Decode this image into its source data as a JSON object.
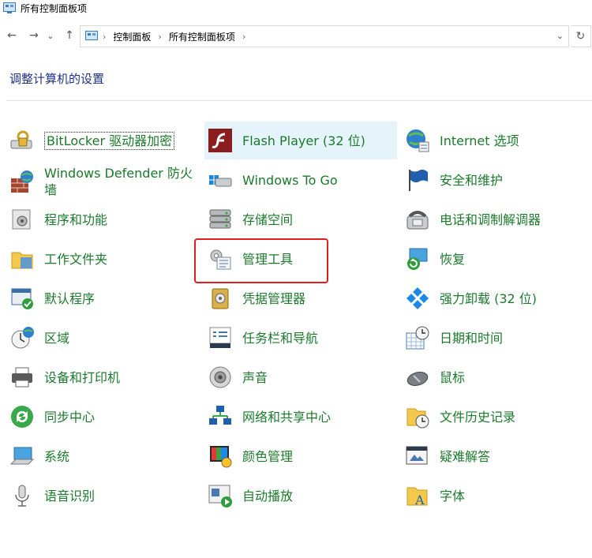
{
  "window": {
    "title": "所有控制面板项"
  },
  "nav": {
    "back": "←",
    "forward": "→",
    "recent": "⌄",
    "up": "↑",
    "refresh": "↻",
    "dropdown": "⌄",
    "separator": "›",
    "breadcrumb": [
      "控制面板",
      "所有控制面板项"
    ]
  },
  "page": {
    "heading": "调整计算机的设置"
  },
  "columns": [
    [
      {
        "label": "BitLocker 驱动器加密",
        "icon": "bitlocker-icon"
      },
      {
        "label": "Windows Defender 防火墙",
        "icon": "firewall-icon"
      },
      {
        "label": "程序和功能",
        "icon": "programs-icon"
      },
      {
        "label": "工作文件夹",
        "icon": "work-folders-icon"
      },
      {
        "label": "默认程序",
        "icon": "default-programs-icon"
      },
      {
        "label": "区域",
        "icon": "region-icon"
      },
      {
        "label": "设备和打印机",
        "icon": "printer-icon"
      },
      {
        "label": "同步中心",
        "icon": "sync-icon"
      },
      {
        "label": "系统",
        "icon": "system-icon"
      },
      {
        "label": "语音识别",
        "icon": "microphone-icon"
      }
    ],
    [
      {
        "label": "Flash Player (32 位)",
        "icon": "flash-icon"
      },
      {
        "label": "Windows To Go",
        "icon": "usb-drive-icon"
      },
      {
        "label": "存储空间",
        "icon": "storage-icon"
      },
      {
        "label": "管理工具",
        "icon": "admin-tools-icon"
      },
      {
        "label": "凭据管理器",
        "icon": "credential-icon"
      },
      {
        "label": "任务栏和导航",
        "icon": "taskbar-icon"
      },
      {
        "label": "声音",
        "icon": "speaker-icon"
      },
      {
        "label": "网络和共享中心",
        "icon": "network-icon"
      },
      {
        "label": "颜色管理",
        "icon": "color-icon"
      },
      {
        "label": "自动播放",
        "icon": "autoplay-icon"
      }
    ],
    [
      {
        "label": "Internet 选项",
        "icon": "internet-icon"
      },
      {
        "label": "安全和维护",
        "icon": "flag-icon"
      },
      {
        "label": "电话和调制解调器",
        "icon": "phone-icon"
      },
      {
        "label": "恢复",
        "icon": "recovery-icon"
      },
      {
        "label": "强力卸载 (32 位)",
        "icon": "uninstall-icon"
      },
      {
        "label": "日期和时间",
        "icon": "clock-icon"
      },
      {
        "label": "鼠标",
        "icon": "mouse-icon"
      },
      {
        "label": "文件历史记录",
        "icon": "file-history-icon"
      },
      {
        "label": "疑难解答",
        "icon": "troubleshoot-icon"
      },
      {
        "label": "字体",
        "icon": "font-icon"
      }
    ]
  ],
  "colors": {
    "link": "#1b7a2b",
    "heading": "#1e3287",
    "highlight": "#e5f3fb",
    "annotation": "#e02020"
  }
}
